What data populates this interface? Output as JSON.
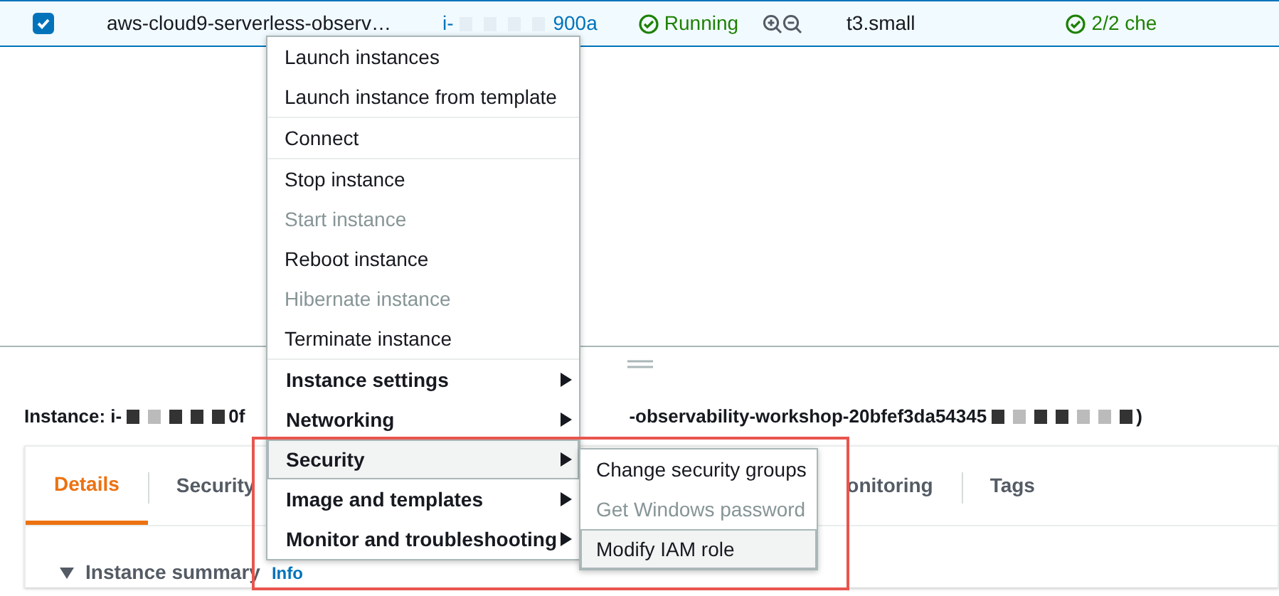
{
  "instance_row": {
    "checked": true,
    "selected": true,
    "name": "aws-cloud9-serverless-observ…",
    "id_start": "i-",
    "id_end": "900a",
    "state": "Running",
    "type": "t3.small",
    "status_check": "2/2 che"
  },
  "details_header": {
    "parts": [
      "Instance: i-",
      "0f",
      "-observability-workshop-20bfef3da54345",
      ")"
    ]
  },
  "tabs": [
    {
      "label": "Details",
      "selected": true
    },
    {
      "label": "Security",
      "selected": false
    },
    {
      "label": "onitoring",
      "selected": false
    },
    {
      "label": "Tags",
      "selected": false
    }
  ],
  "summary": {
    "label": "Instance summary",
    "expanded": true,
    "link": "Info"
  },
  "context_menu": {
    "groups": [
      [
        {
          "label": "Launch instances",
          "disabled": false,
          "submenu": false,
          "selected": false
        },
        {
          "label": "Launch instance from template",
          "disabled": false,
          "submenu": false,
          "selected": false
        }
      ],
      [
        {
          "label": "Connect",
          "disabled": false,
          "submenu": false,
          "selected": false
        }
      ],
      [
        {
          "label": "Stop instance",
          "disabled": false,
          "submenu": false,
          "selected": false
        },
        {
          "label": "Start instance",
          "disabled": true,
          "submenu": false,
          "selected": false
        },
        {
          "label": "Reboot instance",
          "disabled": false,
          "submenu": false,
          "selected": false
        },
        {
          "label": "Hibernate instance",
          "disabled": true,
          "submenu": false,
          "selected": false
        },
        {
          "label": "Terminate instance",
          "disabled": false,
          "submenu": false,
          "selected": false
        }
      ],
      [
        {
          "label": "Instance settings",
          "disabled": false,
          "submenu": true,
          "selected": false
        },
        {
          "label": "Networking",
          "disabled": false,
          "submenu": true,
          "selected": false
        },
        {
          "label": "Security",
          "disabled": false,
          "submenu": true,
          "selected": true
        },
        {
          "label": "Image and templates",
          "disabled": false,
          "submenu": true,
          "selected": false
        },
        {
          "label": "Monitor and troubleshooting",
          "disabled": false,
          "submenu": true,
          "selected": false
        }
      ]
    ],
    "submenu": [
      {
        "label": "Change security groups",
        "disabled": false,
        "selected": false
      },
      {
        "label": "Get Windows password",
        "disabled": true,
        "selected": false
      },
      {
        "label": "Modify IAM role",
        "disabled": false,
        "selected": true
      }
    ]
  }
}
